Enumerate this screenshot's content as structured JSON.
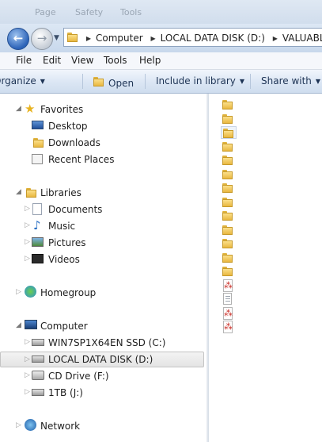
{
  "browser_toolbar": {
    "items": [
      "Page",
      "Safety",
      "Tools"
    ]
  },
  "address_bar": {
    "crumbs": [
      "Computer",
      "LOCAL DATA DISK (D:)",
      "VALUABLE_I"
    ]
  },
  "menu": [
    "File",
    "Edit",
    "View",
    "Tools",
    "Help"
  ],
  "commands": {
    "organize": "Organize",
    "open": "Open",
    "include": "Include in library",
    "share": "Share with"
  },
  "nav": {
    "favorites": "Favorites",
    "desktop": "Desktop",
    "downloads": "Downloads",
    "recent_places": "Recent Places",
    "libraries": "Libraries",
    "documents": "Documents",
    "music": "Music",
    "pictures": "Pictures",
    "videos": "Videos",
    "homegroup": "Homegroup",
    "computer": "Computer",
    "drive_c": "WIN7SP1X64EN SSD (C:)",
    "drive_d": "LOCAL DATA DISK (D:)",
    "drive_f": "CD Drive (F:)",
    "drive_j": "1TB (J:)",
    "network": "Network"
  },
  "files": [
    "folder",
    "folder",
    "folder",
    "folder",
    "folder",
    "folder",
    "folder",
    "folder",
    "folder",
    "folder",
    "folder",
    "folder",
    "folder",
    "pdf",
    "txt",
    "pdf",
    "pdf"
  ],
  "icons": {
    "back": "back-arrow-icon",
    "forward": "forward-arrow-icon",
    "folder": "folder-icon",
    "pdf": "pdf-icon",
    "txt": "text-file-icon"
  }
}
